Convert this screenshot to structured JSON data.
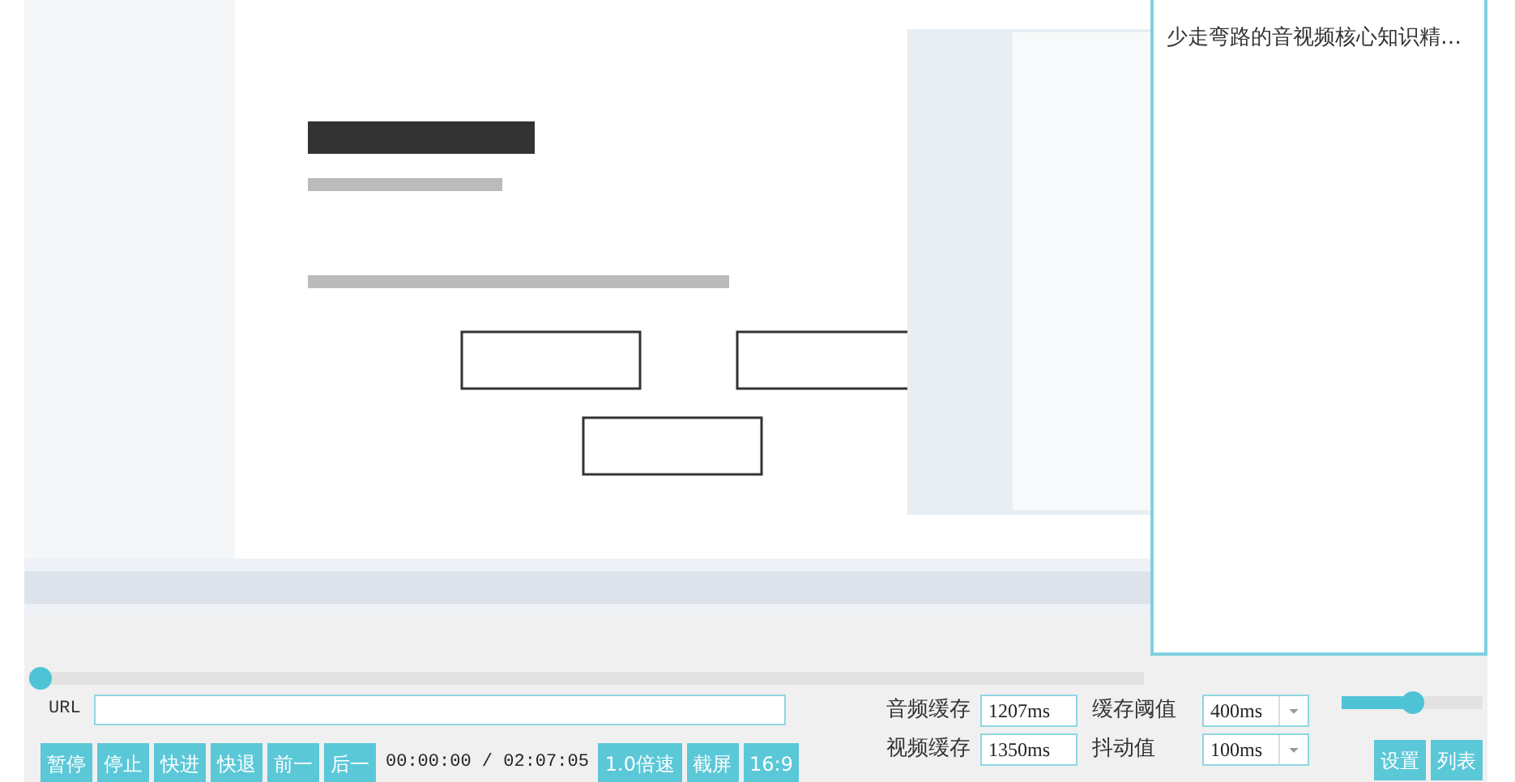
{
  "playlist": {
    "items": [
      {
        "title": "少走弯路的音视频核心知识精…",
        "selected": false
      }
    ]
  },
  "progress": {
    "level": 0
  },
  "url": {
    "label": "URL"
  },
  "buttons": [
    {
      "label": "暂停"
    },
    {
      "label": "停止"
    },
    {
      "label": "快进"
    },
    {
      "label": "快退"
    },
    {
      "label": "前一"
    },
    {
      "label": "后一"
    }
  ],
  "time": {
    "current": "00:00:00",
    "separator": "/",
    "total": "02:07:05"
  },
  "extra_buttons": [
    {
      "label": "1.0倍速"
    },
    {
      "label": "截屏"
    },
    {
      "label": "16:9"
    }
  ],
  "buffers": [
    {
      "label": "音频缓存",
      "value": "1207ms",
      "threshold_label": "缓存阈值",
      "threshold": "400ms"
    },
    {
      "label": "视频缓存",
      "value": "1350ms",
      "threshold_label": "抖动值",
      "threshold": "100ms"
    }
  ],
  "volume": {
    "level": 0.5
  },
  "side_buttons": [
    {
      "label": "设置"
    },
    {
      "label": "列表"
    }
  ]
}
